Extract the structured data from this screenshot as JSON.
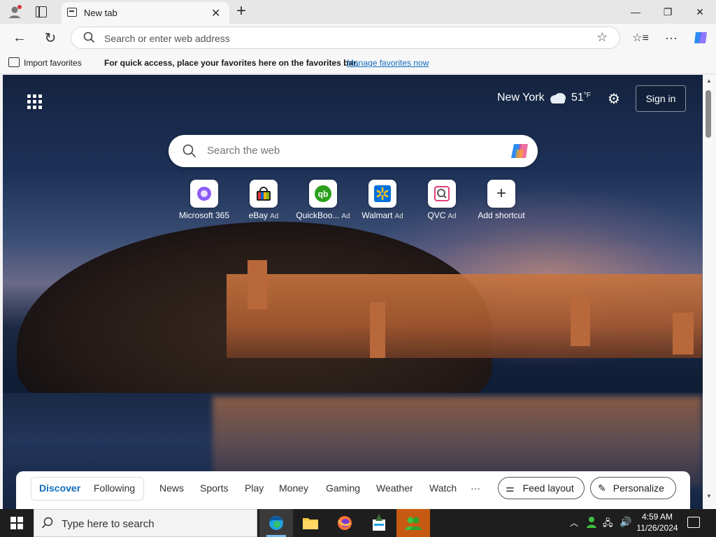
{
  "browser": {
    "tab_title": "New tab",
    "address_placeholder": "Search or enter web address"
  },
  "favorites_bar": {
    "import_label": "Import favorites",
    "message": "For quick access, place your favorites here on the favorites bar.",
    "manage_link": "Manage favorites now"
  },
  "newtab": {
    "weather": {
      "city": "New York",
      "temp": "51",
      "unit": "°F"
    },
    "signin_label": "Sign in",
    "search_placeholder": "Search the web",
    "ad_label": "Ad",
    "shortcuts": [
      {
        "label": "Microsoft 365",
        "ad": false,
        "icon": "microsoft-365-icon"
      },
      {
        "label": "eBay",
        "ad": true,
        "icon": "ebay-icon"
      },
      {
        "label": "QuickBoo...",
        "ad": true,
        "icon": "quickbooks-icon"
      },
      {
        "label": "Walmart",
        "ad": true,
        "icon": "walmart-icon"
      },
      {
        "label": "QVC",
        "ad": true,
        "icon": "qvc-icon"
      },
      {
        "label": "Add shortcut",
        "ad": false,
        "icon": "plus-icon"
      }
    ],
    "feed_nav": {
      "discover": "Discover",
      "following": "Following",
      "items": [
        "News",
        "Sports",
        "Play",
        "Money",
        "Gaming",
        "Weather",
        "Watch"
      ],
      "more": "···",
      "feed_layout": "Feed layout",
      "personalize": "Personalize"
    }
  },
  "taskbar": {
    "search_placeholder": "Type here to search",
    "time": "4:59 AM",
    "date": "11/26/2024"
  },
  "colors": {
    "accent": "#0f6cbd",
    "link": "#0f6cbd"
  }
}
